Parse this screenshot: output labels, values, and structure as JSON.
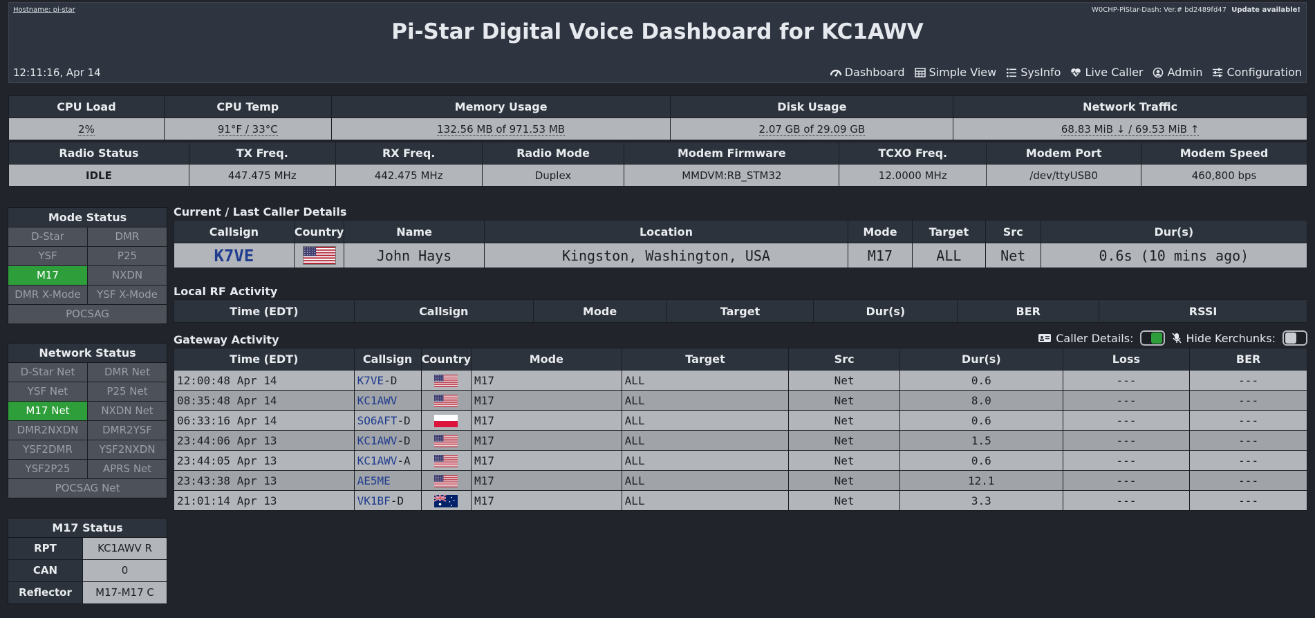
{
  "header": {
    "hostname": "Hostname: pi-star",
    "version": "W0CHP-PiStar-Dash: Ver.# bd2489fd47",
    "update_notice": "Update available!",
    "title": "Pi-Star Digital Voice Dashboard for KC1AWV",
    "clock": "12:11:16, Apr 14",
    "nav": [
      {
        "label": "Dashboard",
        "icon": "dashboard-icon"
      },
      {
        "label": "Simple View",
        "icon": "table-icon"
      },
      {
        "label": "SysInfo",
        "icon": "list-icon"
      },
      {
        "label": "Live Caller",
        "icon": "heartbeat-icon"
      },
      {
        "label": "Admin",
        "icon": "user-circle-icon"
      },
      {
        "label": "Configuration",
        "icon": "sliders-icon"
      }
    ]
  },
  "system": {
    "headers": [
      "CPU Load",
      "CPU Temp",
      "Memory Usage",
      "Disk Usage",
      "Network Traffic"
    ],
    "values": [
      "2%",
      "91°F / 33°C",
      "132.56 MB of 971.53 MB",
      "2.07 GB of 29.09 GB",
      "68.83 MiB ↓ / 69.53 MiB ↑"
    ]
  },
  "radio": {
    "headers": [
      "Radio Status",
      "TX Freq.",
      "RX Freq.",
      "Radio Mode",
      "Modem Firmware",
      "TCXO Freq.",
      "Modem Port",
      "Modem Speed"
    ],
    "values": [
      "IDLE",
      "447.475 MHz",
      "442.475 MHz",
      "Duplex",
      "MMDVM:RB_STM32",
      "12.0000 MHz",
      "/dev/ttyUSB0",
      "460,800 bps"
    ]
  },
  "mode_status": {
    "title": "Mode Status",
    "items": [
      "D-Star",
      "DMR",
      "YSF",
      "P25",
      "M17",
      "NXDN",
      "DMR X-Mode",
      "YSF X-Mode",
      "POCSAG"
    ],
    "active": "M17"
  },
  "network_status": {
    "title": "Network Status",
    "items": [
      "D-Star Net",
      "DMR Net",
      "YSF Net",
      "P25 Net",
      "M17 Net",
      "NXDN Net",
      "DMR2NXDN",
      "DMR2YSF",
      "YSF2DMR",
      "YSF2NXDN",
      "YSF2P25",
      "APRS Net",
      "POCSAG Net"
    ],
    "active": "M17 Net"
  },
  "m17_status": {
    "title": "M17 Status",
    "rows": [
      {
        "key": "RPT",
        "value": "KC1AWV R"
      },
      {
        "key": "CAN",
        "value": "0"
      },
      {
        "key": "Reflector",
        "value": "M17-M17 C"
      }
    ]
  },
  "caller": {
    "label": "Current / Last Caller Details",
    "headers": [
      "Callsign",
      "Country",
      "Name",
      "Location",
      "Mode",
      "Target",
      "Src",
      "Dur(s)"
    ],
    "row": {
      "callsign": "K7VE",
      "country": "us",
      "name": "John Hays",
      "location": "Kingston, Washington, USA",
      "mode": "M17",
      "target": "ALL",
      "src": "Net",
      "dur": "0.6s (10 mins ago)"
    }
  },
  "local_rf": {
    "label": "Local RF Activity",
    "headers": [
      "Time (EDT)",
      "Callsign",
      "Mode",
      "Target",
      "Dur(s)",
      "BER",
      "RSSI"
    ]
  },
  "gateway": {
    "label": "Gateway Activity",
    "caller_details_label": "Caller Details:",
    "hide_kerchunks_label": "Hide Kerchunks:",
    "caller_details_on": true,
    "hide_kerchunks_on": false,
    "headers": [
      "Time (EDT)",
      "Callsign",
      "Country",
      "Mode",
      "Target",
      "Src",
      "Dur(s)",
      "Loss",
      "BER"
    ],
    "rows": [
      {
        "time": "12:00:48 Apr 14",
        "callsign": "K7VE",
        "suffix": "-D",
        "country": "us",
        "mode": "M17",
        "target": "ALL",
        "src": "Net",
        "dur": "0.6",
        "loss": "---",
        "ber": "---"
      },
      {
        "time": "08:35:48 Apr 14",
        "callsign": "KC1AWV",
        "suffix": "",
        "country": "us",
        "mode": "M17",
        "target": "ALL",
        "src": "Net",
        "dur": "8.0",
        "loss": "---",
        "ber": "---"
      },
      {
        "time": "06:33:16 Apr 14",
        "callsign": "SO6AFT",
        "suffix": "-D",
        "country": "pl",
        "mode": "M17",
        "target": "ALL",
        "src": "Net",
        "dur": "0.6",
        "loss": "---",
        "ber": "---"
      },
      {
        "time": "23:44:06 Apr 13",
        "callsign": "KC1AWV",
        "suffix": "-D",
        "country": "us",
        "mode": "M17",
        "target": "ALL",
        "src": "Net",
        "dur": "1.5",
        "loss": "---",
        "ber": "---"
      },
      {
        "time": "23:44:05 Apr 13",
        "callsign": "KC1AWV",
        "suffix": "-A",
        "country": "us",
        "mode": "M17",
        "target": "ALL",
        "src": "Net",
        "dur": "0.6",
        "loss": "---",
        "ber": "---"
      },
      {
        "time": "23:43:38 Apr 13",
        "callsign": "AE5ME",
        "suffix": "",
        "country": "us",
        "mode": "M17",
        "target": "ALL",
        "src": "Net",
        "dur": "12.1",
        "loss": "---",
        "ber": "---"
      },
      {
        "time": "21:01:14 Apr 13",
        "callsign": "VK1BF",
        "suffix": "-D",
        "country": "au",
        "mode": "M17",
        "target": "ALL",
        "src": "Net",
        "dur": "3.3",
        "loss": "---",
        "ber": "---"
      }
    ]
  },
  "colors": {
    "active_green": "#2e9e3a",
    "callsign_blue": "#1f3c8f",
    "panel_header": "#2d333d",
    "cell_gray": "#b2b5b9"
  }
}
